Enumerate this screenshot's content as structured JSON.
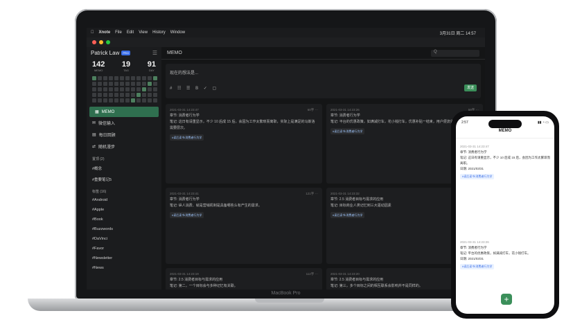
{
  "menubar": {
    "app": "Xnote",
    "items": [
      "File",
      "Edit",
      "View",
      "History",
      "Window"
    ],
    "clock": "3月31日 周二 14:57"
  },
  "sidebar": {
    "user": "Patrick Law",
    "badge": "PRO",
    "stats": [
      {
        "n": "142",
        "l": "MEMO"
      },
      {
        "n": "19",
        "l": "TAG"
      },
      {
        "n": "91",
        "l": "DAY"
      }
    ],
    "nav": [
      "MEMO",
      "微信输入",
      "每日回顾",
      "随机漫步"
    ],
    "sec_pinned": "置顶 (2)",
    "pinned": [
      "#概念",
      "#重要笔记5"
    ],
    "sec_tags": "标签 (16)",
    "tags": [
      "#Android",
      "#Apple",
      "#Book",
      "#Buzzwords",
      "#DaVinci",
      "#Favor",
      "#Newsletter",
      "#News"
    ]
  },
  "main": {
    "title": "MEMO",
    "search": "Q",
    "placeholder": "现在的想法是...",
    "send": "发送",
    "tools": "# ☷ ☰ B ✓ ▢",
    "cards": [
      {
        "date": "2021-03-31 14:23:47",
        "count": "60字 ···",
        "body": "章节: 消费者行为学\n笔记: 这日有请重显示，不少 10 后成 15 后，会因为工作太繁琐而离职，实际上是满足的马斯洛需要层次。",
        "tag": "#读后读书/消费者行为学"
      },
      {
        "date": "2021-03-31 14:23:26",
        "count": "59字 ···",
        "body": "章节: 消费者行为学\n笔记: 平台的优惠政策，如满减打车，花小钱打车，优惠补贴一结束，用户便流失。",
        "tag": "#读后读书/消费者行为学"
      },
      {
        "date": "2021-03-31 14:23:41",
        "count": "121字 ···",
        "body": "章节: 消费者行为学\n笔记: 纵人消费、就是营销机制是具备哪些么有产生的需求。",
        "tag": "#读后读书/消费者行为学"
      },
      {
        "date": "2021-03-31 14:23:32",
        "count": "46字 ···",
        "body": "章节: 2.5 消费者目标与需求的应用\n笔记: 目标商业人类记忆到三大驱动因素",
        "tag": "#读后读书/消费者行为学"
      },
      {
        "date": "2021-03-31 14:23:19",
        "count": "112字 ···",
        "body": "章节: 2.5 消费者目标与需求的应用\n笔记: 第二，一个目标会与多种记忆有关联。",
        "tag": ""
      },
      {
        "date": "2021-03-31 14:23:20",
        "count": "···",
        "body": "章节: 2.5 消费者目标与需求的应用\n笔记: 第三，多个目标之间的相互联系会影响并不是同样的。",
        "tag": ""
      }
    ]
  },
  "laptop_brand": "MacBook Pro",
  "phone": {
    "time": "2:57",
    "title": "MEMO",
    "cards": [
      {
        "meta": "2021-03-31 14:23:47",
        "body": "章节: 消费者行为学\n笔记: 这日有请重显示，不少 10 后成 15 后，会因为工作太繁琐而离职。\n日期: 2021/03/31",
        "tag": "#读后读书/消费者行为学"
      },
      {
        "meta": "2021-03-31 14:23:26",
        "body": "章节: 消费者行为学\n笔记: 平台的优惠政策，如满减打车，花小钱打车。\n日期: 2021/03/31",
        "tag": "#读后读书/消费者行为学"
      }
    ],
    "fab": "+"
  }
}
